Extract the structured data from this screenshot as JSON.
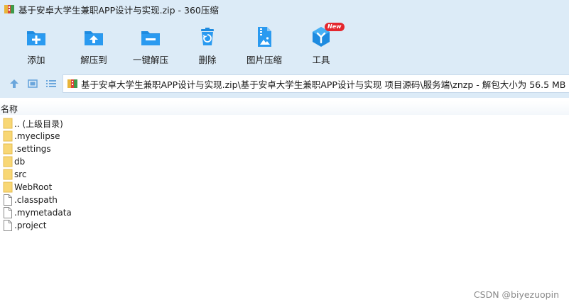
{
  "window": {
    "title": "基于安卓大学生兼职APP设计与实现.zip - 360压缩"
  },
  "colors": {
    "chrome_bg": "#dcebf7",
    "icon_blue": "#1e8be0",
    "folder_yellow": "#f8d775",
    "badge_red": "#e4262d"
  },
  "toolbar": {
    "buttons": [
      {
        "label": "添加",
        "icon": "add-icon"
      },
      {
        "label": "解压到",
        "icon": "extract-to-icon"
      },
      {
        "label": "一键解压",
        "icon": "one-click-extract-icon"
      },
      {
        "label": "删除",
        "icon": "delete-icon"
      },
      {
        "label": "图片压缩",
        "icon": "image-compress-icon"
      },
      {
        "label": "工具",
        "icon": "tools-icon",
        "badge": "New"
      }
    ]
  },
  "nav": {
    "up_icon": "up-arrow-icon",
    "view_thumbnail_icon": "thumbnail-view-icon",
    "view_list_icon": "list-view-icon",
    "path": "基于安卓大学生兼职APP设计与实现.zip\\基于安卓大学生兼职APP设计与实现 项目源码\\服务端\\znzp - 解包大小为 56.5 MB"
  },
  "list": {
    "column_name": "名称",
    "items": [
      {
        "name": ".. (上级目录)",
        "type": "folder"
      },
      {
        "name": ".myeclipse",
        "type": "folder"
      },
      {
        "name": ".settings",
        "type": "folder"
      },
      {
        "name": "db",
        "type": "folder"
      },
      {
        "name": "src",
        "type": "folder"
      },
      {
        "name": "WebRoot",
        "type": "folder"
      },
      {
        "name": ".classpath",
        "type": "file"
      },
      {
        "name": ".mymetadata",
        "type": "file"
      },
      {
        "name": ".project",
        "type": "file"
      }
    ]
  },
  "watermark": "CSDN @biyezuopin"
}
